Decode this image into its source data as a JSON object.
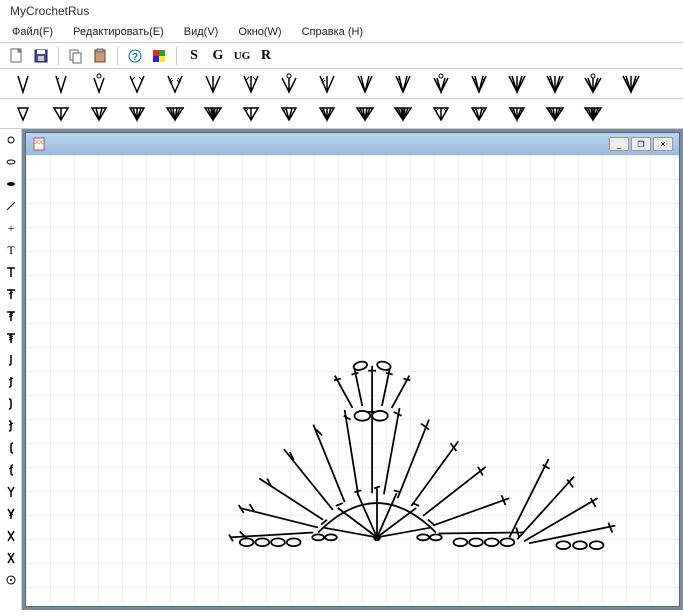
{
  "app": {
    "title": "MyCrochetRus"
  },
  "menu": {
    "file": "Файл(F)",
    "edit": "Редактировать(E)",
    "view": "Вид(V)",
    "window": "Окно(W)",
    "help": "Справка (H)"
  },
  "toolbar1": {
    "letters": [
      "S",
      "G",
      "UG",
      "R"
    ]
  },
  "icons": {
    "doc": "doc",
    "minimize": "_",
    "maximize": "❐",
    "close": "✕"
  }
}
